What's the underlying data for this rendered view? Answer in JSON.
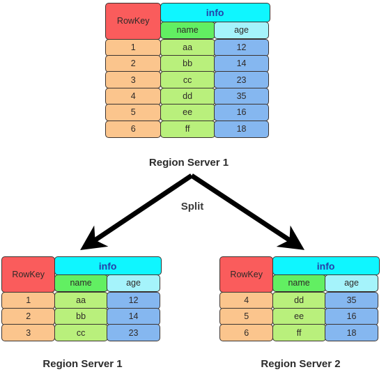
{
  "diagram": {
    "title_icon": "split-arrows",
    "split_label": "Split",
    "column_headers": {
      "rowkey": "RowKey",
      "family": "info",
      "name": "name",
      "age": "age"
    },
    "colors": {
      "rowkey_header": "#FA5C5C",
      "family_header": "#0FF6FF",
      "family_header_text": "#2540A8",
      "name_header": "#62EF62",
      "age_header": "#A5F3FB",
      "rowkey_cell": "#FBC58D",
      "name_cell": "#B9F07C",
      "age_cell": "#85B7F0",
      "border": "#3A3330",
      "background": "#FFFFFF",
      "arrow": "#000000"
    },
    "tables": [
      {
        "id": "source-table",
        "caption": "Region Server 1",
        "rows": [
          {
            "rowkey": "1",
            "name": "aa",
            "age": "12"
          },
          {
            "rowkey": "2",
            "name": "bb",
            "age": "14"
          },
          {
            "rowkey": "3",
            "name": "cc",
            "age": "23"
          },
          {
            "rowkey": "4",
            "name": "dd",
            "age": "35"
          },
          {
            "rowkey": "5",
            "name": "ee",
            "age": "16"
          },
          {
            "rowkey": "6",
            "name": "ff",
            "age": "18"
          }
        ]
      },
      {
        "id": "split-table-left",
        "caption": "Region Server 1",
        "rows": [
          {
            "rowkey": "1",
            "name": "aa",
            "age": "12"
          },
          {
            "rowkey": "2",
            "name": "bb",
            "age": "14"
          },
          {
            "rowkey": "3",
            "name": "cc",
            "age": "23"
          }
        ]
      },
      {
        "id": "split-table-right",
        "caption": "Region Server 2",
        "rows": [
          {
            "rowkey": "4",
            "name": "dd",
            "age": "35"
          },
          {
            "rowkey": "5",
            "name": "ee",
            "age": "16"
          },
          {
            "rowkey": "6",
            "name": "ff",
            "age": "18"
          }
        ]
      }
    ]
  }
}
